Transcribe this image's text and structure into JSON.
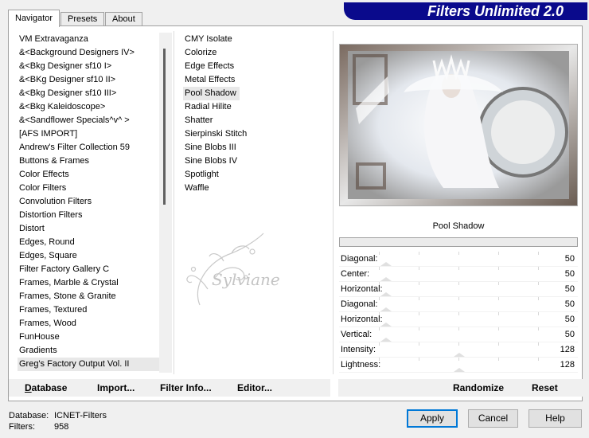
{
  "tabs": [
    {
      "label": "Navigator",
      "active": true
    },
    {
      "label": "Presets",
      "active": false
    },
    {
      "label": "About",
      "active": false
    }
  ],
  "app_title": "Filters Unlimited 2.0",
  "categories": [
    "VM Extravaganza",
    "&<Background Designers IV>",
    "&<Bkg Designer sf10 I>",
    "&<BKg Designer sf10 II>",
    "&<Bkg Designer sf10 III>",
    "&<Bkg Kaleidoscope>",
    "&<Sandflower Specials^v^ >",
    "[AFS IMPORT]",
    "Andrew's Filter Collection 59",
    "Buttons & Frames",
    "Color Effects",
    "Color Filters",
    "Convolution Filters",
    "Distortion Filters",
    "Distort",
    "Edges, Round",
    "Edges, Square",
    "Filter Factory Gallery C",
    "Frames, Marble & Crystal",
    "Frames, Stone & Granite",
    "Frames, Textured",
    "Frames, Wood",
    "FunHouse",
    "Gradients",
    "Greg's Factory Output Vol. II"
  ],
  "selected_category": "Greg's Factory Output Vol. II",
  "filters": [
    "CMY Isolate",
    "Colorize",
    "Edge Effects",
    "Metal Effects",
    "Pool Shadow",
    "Radial Hilite",
    "Shatter",
    "Sierpinski Stitch",
    "Sine Blobs III",
    "Sine Blobs IV",
    "Spotlight",
    "Waffle"
  ],
  "selected_filter": "Pool Shadow",
  "watermark_text": "Sylviane",
  "preview_filter_name": "Pool Shadow",
  "params": [
    {
      "label": "Diagonal:",
      "value": "50",
      "level": 50
    },
    {
      "label": "Center:",
      "value": "50",
      "level": 50
    },
    {
      "label": "Horizontal:",
      "value": "50",
      "level": 50
    },
    {
      "label": "Diagonal:",
      "value": "50",
      "level": 50
    },
    {
      "label": "Horizontal:",
      "value": "50",
      "level": 50
    },
    {
      "label": "Vertical:",
      "value": "50",
      "level": 50
    },
    {
      "label": "Intensity:",
      "value": "128",
      "level": 128
    },
    {
      "label": "Lightness:",
      "value": "128",
      "level": 128
    }
  ],
  "bottom_links": {
    "database": "Database",
    "import": "Import...",
    "filter_info": "Filter Info...",
    "editor": "Editor...",
    "randomize": "Randomize",
    "reset": "Reset"
  },
  "buttons": {
    "apply": "Apply",
    "cancel": "Cancel",
    "help": "Help"
  },
  "status": {
    "database_label": "Database:",
    "database_value": "ICNET-Filters",
    "filters_label": "Filters:",
    "filters_value": "958"
  },
  "colors": {
    "banner": "#0a0a8c",
    "selection": "#e8e8e8"
  }
}
